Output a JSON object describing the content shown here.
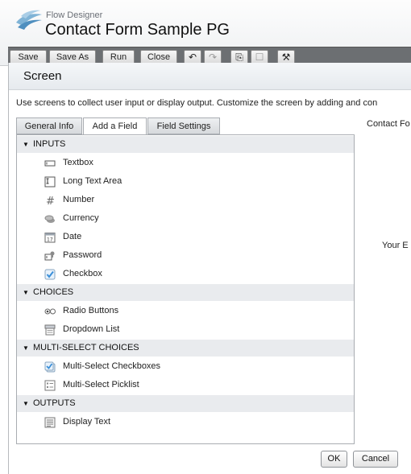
{
  "app": {
    "subtitle": "Flow Designer",
    "title": "Contact Form Sample PG"
  },
  "toolbar": {
    "save_label": "Save",
    "save_as_label": "Save As",
    "run_label": "Run",
    "close_label": "Close"
  },
  "dialog": {
    "title": "Screen",
    "intro": "Use screens to collect user input or display output. Customize the screen by adding and con",
    "tabs": [
      {
        "label": "General Info"
      },
      {
        "label": "Add a Field"
      },
      {
        "label": "Field Settings"
      }
    ],
    "active_tab": "Add a Field",
    "sections": [
      {
        "label": "INPUTS",
        "items": [
          {
            "label": "Textbox",
            "icon": "textbox-icon"
          },
          {
            "label": "Long Text Area",
            "icon": "long-text-area-icon"
          },
          {
            "label": "Number",
            "icon": "number-icon"
          },
          {
            "label": "Currency",
            "icon": "currency-icon"
          },
          {
            "label": "Date",
            "icon": "date-icon"
          },
          {
            "label": "Password",
            "icon": "password-icon"
          },
          {
            "label": "Checkbox",
            "icon": "checkbox-icon"
          }
        ]
      },
      {
        "label": "CHOICES",
        "items": [
          {
            "label": "Radio Buttons",
            "icon": "radio-buttons-icon"
          },
          {
            "label": "Dropdown List",
            "icon": "dropdown-list-icon"
          }
        ]
      },
      {
        "label": "MULTI-SELECT CHOICES",
        "items": [
          {
            "label": "Multi-Select Checkboxes",
            "icon": "multi-select-checkboxes-icon"
          },
          {
            "label": "Multi-Select Picklist",
            "icon": "multi-select-picklist-icon"
          }
        ]
      },
      {
        "label": "OUTPUTS",
        "items": [
          {
            "label": "Display Text",
            "icon": "display-text-icon"
          }
        ]
      }
    ],
    "preview": {
      "contact_text": "Contact Fo",
      "your_text": "Your E"
    },
    "ok_label": "OK",
    "cancel_label": "Cancel"
  },
  "colors": {
    "section_bg": "#e9ebee",
    "toolbar_bg": "#6c6f72",
    "checkbox_accent": "#3a8fd9"
  }
}
